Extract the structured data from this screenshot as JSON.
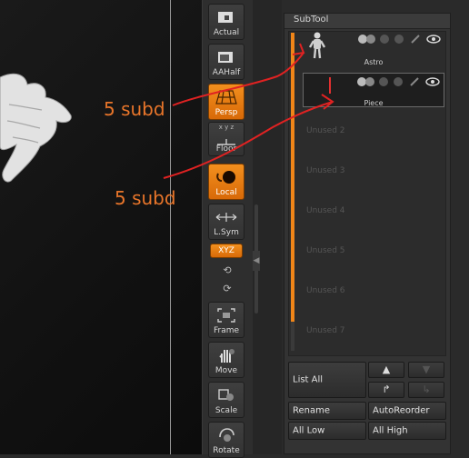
{
  "shelf": {
    "actual": "Actual",
    "aahalf": "AAHalf",
    "persp": "Persp",
    "floor_axes": "x y z",
    "floor": "Floor",
    "local": "Local",
    "lsym": "L.Sym",
    "xyz": "XYZ",
    "frame": "Frame",
    "move": "Move",
    "scale": "Scale",
    "rotate": "Rotate"
  },
  "subtool": {
    "title": "SubTool",
    "rows": [
      {
        "name": "Astro"
      },
      {
        "name": "Piece"
      }
    ],
    "unused": [
      "Unused 2",
      "Unused 3",
      "Unused 4",
      "Unused 5",
      "Unused 6",
      "Unused 7"
    ],
    "list_all": "List All",
    "rename": "Rename",
    "autoreorder": "AutoReorder",
    "all_low": "All Low",
    "all_high": "All High",
    "arrow_up": "▲",
    "arrow_down": "▼",
    "arrow_right_up": "↱",
    "arrow_right_down": "↳"
  },
  "annotations": {
    "label1": "5 subd",
    "label2": "5 subd",
    "color": "#e8752a",
    "line_color": "#e02222"
  },
  "colors": {
    "accent": "#f08518"
  }
}
